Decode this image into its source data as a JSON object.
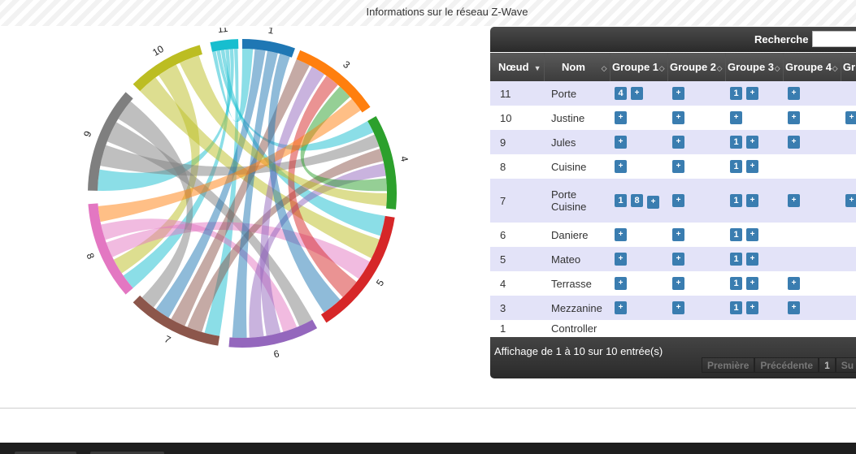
{
  "dialog": {
    "title": "Informations sur le réseau Z-Wave"
  },
  "chord": {
    "nodes": [
      {
        "label": "1",
        "color": "#1f77b4"
      },
      {
        "label": "3",
        "color": "#ff7f0e"
      },
      {
        "label": "4",
        "color": "#2ca02c"
      },
      {
        "label": "5",
        "color": "#d62728"
      },
      {
        "label": "6",
        "color": "#9467bd"
      },
      {
        "label": "7",
        "color": "#8c564b"
      },
      {
        "label": "8",
        "color": "#e377c2"
      },
      {
        "label": "9",
        "color": "#7f7f7f"
      },
      {
        "label": "10",
        "color": "#bcbd22"
      },
      {
        "label": "11",
        "color": "#17becf"
      }
    ]
  },
  "table": {
    "search_label": "Recherche :",
    "search_value": "",
    "columns": [
      {
        "label": "Nœud",
        "sort": "▼"
      },
      {
        "label": "Nom",
        "sort": "◇"
      },
      {
        "label": "Groupe 1",
        "sort": "◇"
      },
      {
        "label": "Groupe 2",
        "sort": "◇"
      },
      {
        "label": "Groupe 3",
        "sort": "◇"
      },
      {
        "label": "Groupe 4",
        "sort": "◇"
      },
      {
        "label": "Gr",
        "sort": ""
      }
    ],
    "rows": [
      {
        "node": "11",
        "name": "Porte",
        "g1": [
          "4",
          "+"
        ],
        "g2": [
          "+"
        ],
        "g3": [
          "1",
          "+"
        ],
        "g4": [
          "+"
        ],
        "g5": []
      },
      {
        "node": "10",
        "name": "Justine",
        "g1": [
          "+"
        ],
        "g2": [
          "+"
        ],
        "g3": [
          "+"
        ],
        "g4": [
          "+"
        ],
        "g5": [
          "+"
        ]
      },
      {
        "node": "9",
        "name": "Jules",
        "g1": [
          "+"
        ],
        "g2": [
          "+"
        ],
        "g3": [
          "1",
          "+"
        ],
        "g4": [
          "+"
        ],
        "g5": []
      },
      {
        "node": "8",
        "name": "Cuisine",
        "g1": [
          "+"
        ],
        "g2": [
          "+"
        ],
        "g3": [
          "1",
          "+"
        ],
        "g4": [],
        "g5": []
      },
      {
        "node": "7",
        "name": "Porte Cuisine",
        "g1": [
          "1",
          "8",
          "+"
        ],
        "g2": [
          "+"
        ],
        "g3": [
          "1",
          "+"
        ],
        "g4": [
          "+"
        ],
        "g5": [
          "+"
        ]
      },
      {
        "node": "6",
        "name": "Daniere",
        "g1": [
          "+"
        ],
        "g2": [
          "+"
        ],
        "g3": [
          "1",
          "+"
        ],
        "g4": [],
        "g5": []
      },
      {
        "node": "5",
        "name": "Mateo",
        "g1": [
          "+"
        ],
        "g2": [
          "+"
        ],
        "g3": [
          "1",
          "+"
        ],
        "g4": [],
        "g5": []
      },
      {
        "node": "4",
        "name": "Terrasse",
        "g1": [
          "+"
        ],
        "g2": [
          "+"
        ],
        "g3": [
          "1",
          "+"
        ],
        "g4": [
          "+"
        ],
        "g5": []
      },
      {
        "node": "3",
        "name": "Mezzanine",
        "g1": [
          "+"
        ],
        "g2": [
          "+"
        ],
        "g3": [
          "1",
          "+"
        ],
        "g4": [
          "+"
        ],
        "g5": []
      },
      {
        "node": "1",
        "name": "Controller",
        "g1": [],
        "g2": [],
        "g3": [],
        "g4": [],
        "g5": []
      }
    ],
    "info": "Affichage de 1 à 10 sur 10 entrée(s)",
    "pager": [
      "Première",
      "Précédente",
      "1",
      "Su"
    ]
  }
}
